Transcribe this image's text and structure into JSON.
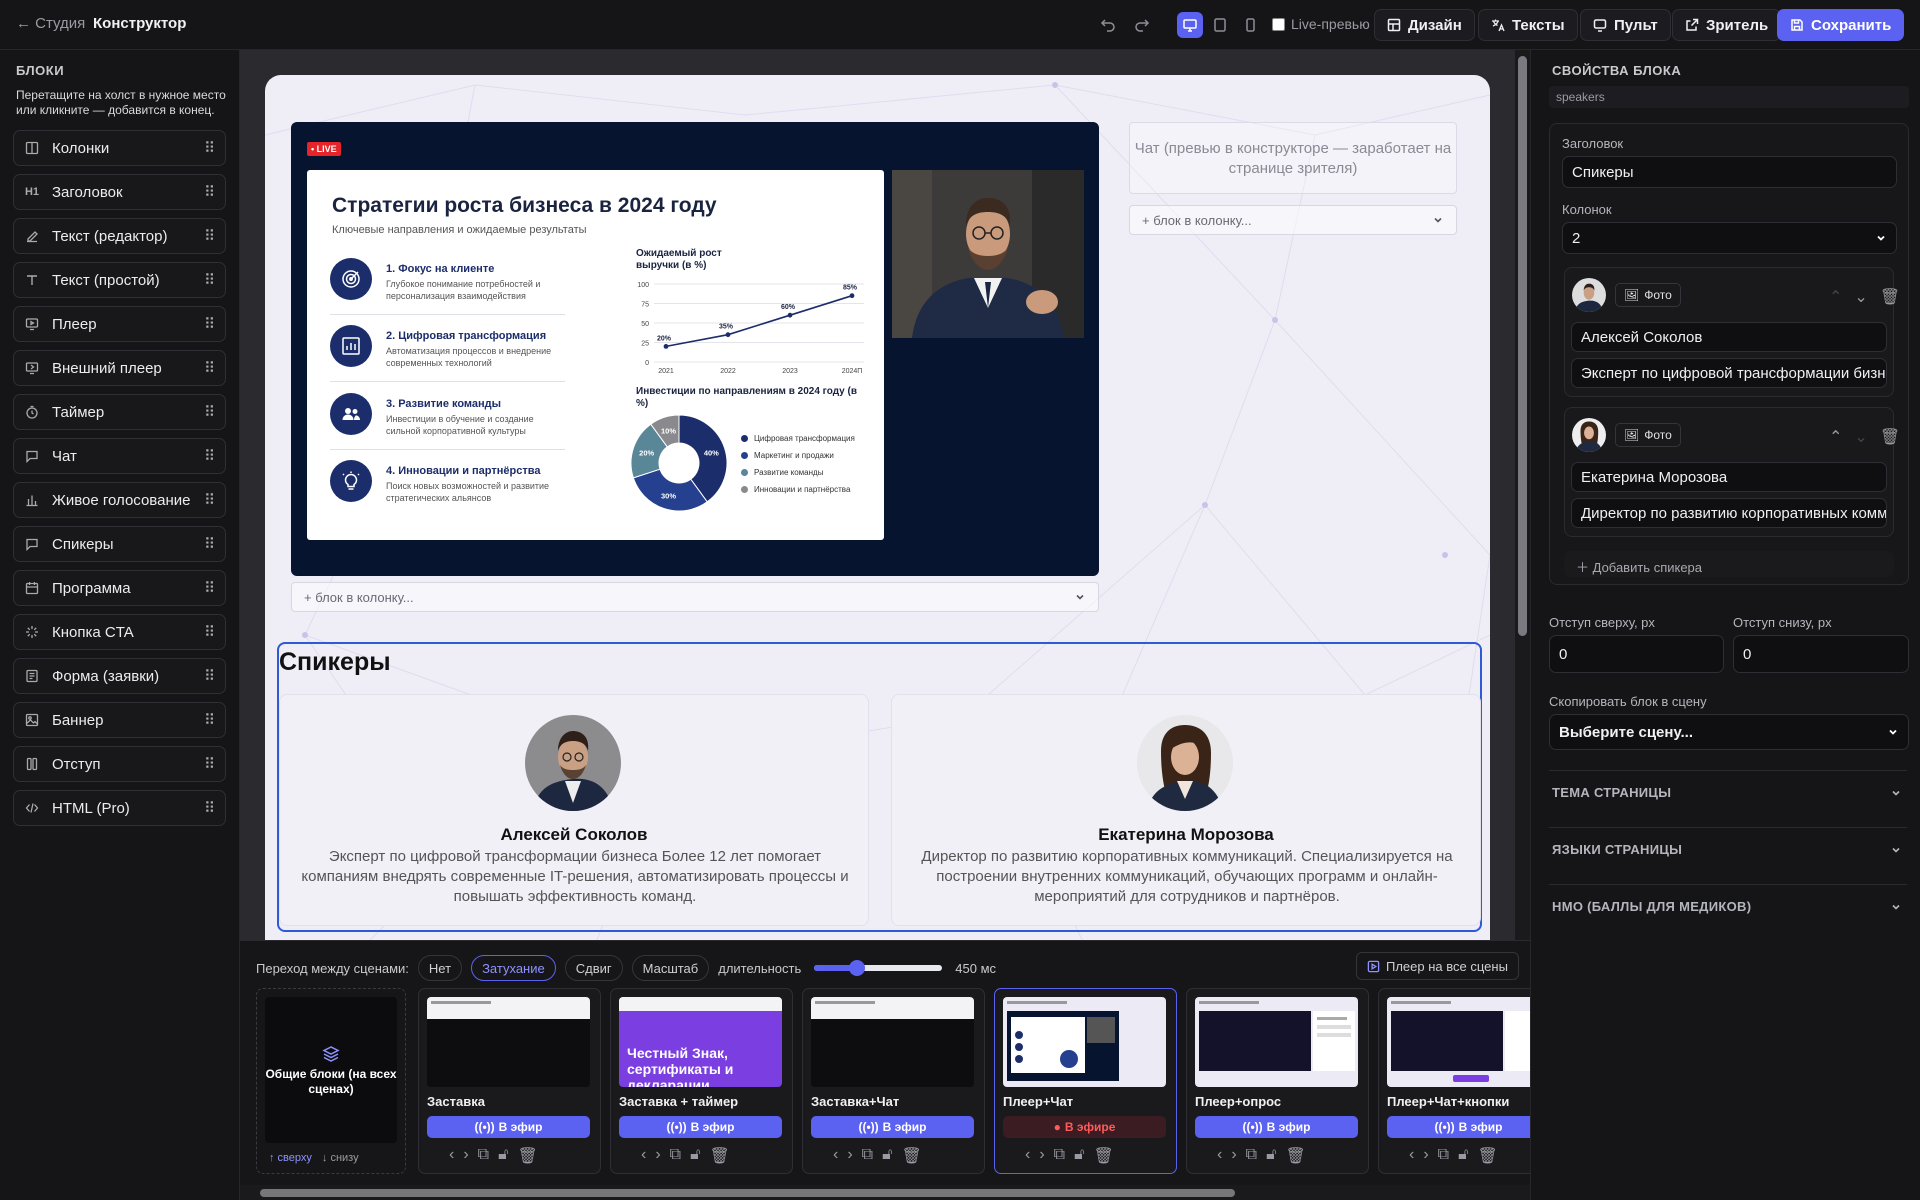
{
  "topbar": {
    "back_label": "← Студия",
    "title": "Конструктор",
    "live_preview_label": "Live-превью",
    "design_label": "Дизайн",
    "texts_label": "Тексты",
    "remote_label": "Пульт",
    "viewer_label": "Зритель",
    "save_label": "Сохранить",
    "accent_color": "#5b61f0"
  },
  "blocks_panel": {
    "title": "БЛОКИ",
    "hint": "Перетащите на холст в нужное место или кликните — добавится в конец.",
    "items": [
      {
        "label": "Колонки",
        "icon": "columns-icon"
      },
      {
        "label": "Заголовок",
        "icon": "heading-icon"
      },
      {
        "label": "Текст (редактор)",
        "icon": "edit-icon"
      },
      {
        "label": "Текст (простой)",
        "icon": "text-icon"
      },
      {
        "label": "Плеер",
        "icon": "player-icon"
      },
      {
        "label": "Внешний плеер",
        "icon": "external-player-icon"
      },
      {
        "label": "Таймер",
        "icon": "timer-icon"
      },
      {
        "label": "Чат",
        "icon": "chat-icon"
      },
      {
        "label": "Живое голосование",
        "icon": "poll-icon"
      },
      {
        "label": "Спикеры",
        "icon": "speakers-icon"
      },
      {
        "label": "Программа",
        "icon": "calendar-icon"
      },
      {
        "label": "Кнопка CTA",
        "icon": "sparkle-icon"
      },
      {
        "label": "Форма (заявки)",
        "icon": "form-icon"
      },
      {
        "label": "Баннер",
        "icon": "image-icon"
      },
      {
        "label": "Отступ",
        "icon": "spacer-icon"
      },
      {
        "label": "HTML (Pro)",
        "icon": "code-icon"
      }
    ]
  },
  "canvas": {
    "live_badge": "• LIVE",
    "slide": {
      "title": "Стратегии роста бизнеса в 2024 году",
      "subtitle": "Ключевые направления и ожидаемые результаты",
      "points": [
        {
          "title": "1. Фокус на клиенте",
          "desc": "Глубокое понимание потребностей и персонализация взаимодействия"
        },
        {
          "title": "2. Цифровая трансформация",
          "desc": "Автоматизация процессов и внедрение современных технологий"
        },
        {
          "title": "3. Развитие команды",
          "desc": "Инвестиции в обучение и создание сильной корпоративной культуры"
        },
        {
          "title": "4. Инновации и партнёрства",
          "desc": "Поиск новых возможностей и развитие стратегических альянсов"
        }
      ],
      "line_chart_title": "Ожидаемый рост выручки (в %)",
      "pie_chart_title": "Инвестиции по направлениям в 2024 году (в %)"
    },
    "chat_placeholder": "Чат (превью в конструкторе — заработает на странице зрителя)",
    "add_to_column": "+ блок в колонку...",
    "speakers_title": "Спикеры",
    "speakers": [
      {
        "name": "Алексей Соколов",
        "desc": "Эксперт по цифровой трансформации бизнеса Более 12 лет помогает компаниям внедрять современные IT-решения, автоматизировать процессы и повышать эффективность команд."
      },
      {
        "name": "Екатерина Морозова",
        "desc": "Директор по развитию корпоративных коммуникаций. Специализируется на построении внутренних коммуникаций, обучающих программ и онлайн-мероприятий для сотрудников и партнёров."
      }
    ]
  },
  "chart_data": [
    {
      "type": "line",
      "title": "Ожидаемый рост выручки (в %)",
      "x": [
        "2021",
        "2022",
        "2023",
        "2024П"
      ],
      "values": [
        20,
        35,
        60,
        85
      ],
      "ylim": [
        0,
        100
      ],
      "yticks": [
        0,
        25,
        50,
        75,
        100
      ],
      "grid": true
    },
    {
      "type": "pie",
      "title": "Инвестиции по направлениям в 2024 году (в %)",
      "categories": [
        "Цифровая трансформация",
        "Маркетинг и продажи",
        "Развитие команды",
        "Инновации и партнёрства"
      ],
      "values": [
        40,
        30,
        20,
        10
      ],
      "colors": [
        "#1c2d6b",
        "#24408f",
        "#5a8798",
        "#8a8a8e"
      ],
      "legend": "right"
    }
  ],
  "transitions": {
    "label": "Переход между сценами:",
    "options": [
      "Нет",
      "Затухание",
      "Сдвиг",
      "Масштаб"
    ],
    "selected": "Затухание",
    "duration_label": "длительность",
    "duration_value": "450 мс",
    "duration_fraction": 0.33,
    "player_all": "Плеер на все сцены"
  },
  "common_blocks": {
    "label": "Общие блоки (на всех сценах)",
    "top": "↑ сверху",
    "bottom": "↓ снизу"
  },
  "scenes": [
    {
      "name": "Заставка",
      "action": "В эфир",
      "on_air": false
    },
    {
      "name": "Заставка + таймер",
      "action": "В эфир",
      "on_air": false,
      "thumb_text": "Честный Знак, сертификаты и декларации"
    },
    {
      "name": "Заставка+Чат",
      "action": "В эфир",
      "on_air": false
    },
    {
      "name": "Плеер+Чат",
      "action": "В эфире",
      "on_air": true
    },
    {
      "name": "Плеер+опрос",
      "action": "В эфир",
      "on_air": false
    },
    {
      "name": "Плеер+Чат+кнопки",
      "action": "В эфир",
      "on_air": false
    }
  ],
  "properties": {
    "title": "СВОЙСТВА БЛОКА",
    "block_id": "speakers",
    "heading_label": "Заголовок",
    "heading_value": "Спикеры",
    "columns_label": "Колонок",
    "columns_value": "2",
    "photo_label": "Фото",
    "speakers": [
      {
        "name": "Алексей Соколов",
        "desc": "Эксперт по цифровой трансформации бизнеса"
      },
      {
        "name": "Екатерина Морозова",
        "desc": "Директор по развитию корпоративных коммуникаций"
      }
    ],
    "add_speaker": "Добавить спикера",
    "padding_top_label": "Отступ сверху, px",
    "padding_top_value": "0",
    "padding_bottom_label": "Отступ снизу, px",
    "padding_bottom_value": "0",
    "copy_label": "Скопировать блок в сцену",
    "copy_placeholder": "Выберите сцену...",
    "sections": [
      "ТЕМА СТРАНИЦЫ",
      "ЯЗЫКИ СТРАНИЦЫ",
      "НМО (БАЛЛЫ ДЛЯ МЕДИКОВ)"
    ]
  }
}
